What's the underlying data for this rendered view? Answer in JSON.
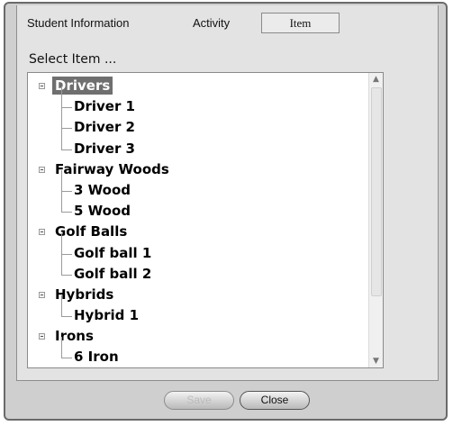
{
  "tabs": {
    "student_information": "Student Information",
    "activity": "Activity",
    "item": "Item"
  },
  "select_label": "Select Item ...",
  "tree": {
    "categories": [
      {
        "label": "Drivers",
        "selected": true,
        "children": [
          "Driver 1",
          "Driver 2",
          "Driver 3"
        ]
      },
      {
        "label": "Fairway Woods",
        "children": [
          "3 Wood",
          "5 Wood"
        ]
      },
      {
        "label": "Golf Balls",
        "children": [
          "Golf ball 1",
          "Golf ball 2"
        ]
      },
      {
        "label": "Hybrids",
        "children": [
          "Hybrid 1"
        ]
      },
      {
        "label": "Irons",
        "children": [
          "6 Iron"
        ]
      }
    ]
  },
  "buttons": {
    "save": "Save",
    "close": "Close"
  },
  "scrollbar": {
    "up_icon": "scroll-up-arrow",
    "down_icon": "scroll-down-arrow"
  }
}
